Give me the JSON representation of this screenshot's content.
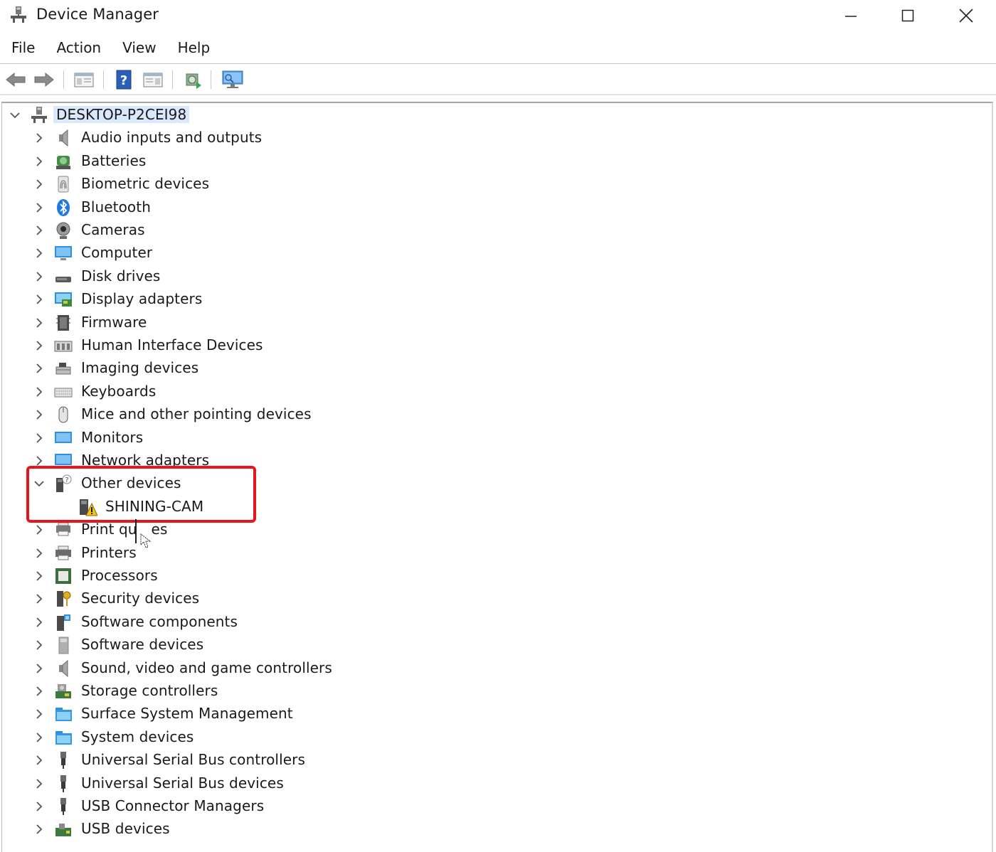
{
  "window": {
    "title": "Device Manager",
    "buttons": [
      "minimize",
      "maximize",
      "close"
    ]
  },
  "menu": [
    "File",
    "Action",
    "View",
    "Help"
  ],
  "toolbar": {
    "icons": [
      "back-arrow-icon",
      "forward-arrow-icon",
      "properties-icon",
      "help-icon",
      "update-driver-icon",
      "scan-hardware-icon",
      "monitor-icon"
    ]
  },
  "tree": {
    "root": {
      "label": "DESKTOP-P2CEI98",
      "expanded": true,
      "selected": true
    },
    "categories": [
      {
        "label": "Audio inputs and outputs",
        "icon": "speaker-icon"
      },
      {
        "label": "Batteries",
        "icon": "battery-icon"
      },
      {
        "label": "Biometric devices",
        "icon": "fingerprint-icon"
      },
      {
        "label": "Bluetooth",
        "icon": "bluetooth-icon"
      },
      {
        "label": "Cameras",
        "icon": "camera-icon"
      },
      {
        "label": "Computer",
        "icon": "computer-icon"
      },
      {
        "label": "Disk drives",
        "icon": "disk-drive-icon"
      },
      {
        "label": "Display adapters",
        "icon": "display-adapter-icon"
      },
      {
        "label": "Firmware",
        "icon": "firmware-icon"
      },
      {
        "label": "Human Interface Devices",
        "icon": "hid-icon"
      },
      {
        "label": "Imaging devices",
        "icon": "imaging-icon"
      },
      {
        "label": "Keyboards",
        "icon": "keyboard-icon"
      },
      {
        "label": "Mice and other pointing devices",
        "icon": "mouse-icon"
      },
      {
        "label": "Monitors",
        "icon": "monitor-icon"
      },
      {
        "label": "Network adapters",
        "icon": "network-adapter-icon"
      },
      {
        "label": "Other devices",
        "icon": "unknown-device-icon",
        "expanded": true,
        "children": [
          {
            "label": "SHINING-CAM",
            "icon": "warning-device-icon"
          }
        ]
      },
      {
        "label": "Print qu",
        "icon": "print-queue-icon",
        "occluded_suffix": "es"
      },
      {
        "label": "Printers",
        "icon": "printer-icon"
      },
      {
        "label": "Processors",
        "icon": "processor-icon"
      },
      {
        "label": "Security devices",
        "icon": "security-key-icon"
      },
      {
        "label": "Software components",
        "icon": "software-component-icon"
      },
      {
        "label": "Software devices",
        "icon": "software-device-icon"
      },
      {
        "label": "Sound, video and game controllers",
        "icon": "speaker-icon"
      },
      {
        "label": "Storage controllers",
        "icon": "storage-controller-icon"
      },
      {
        "label": "Surface System Management",
        "icon": "folder-icon"
      },
      {
        "label": "System devices",
        "icon": "folder-icon"
      },
      {
        "label": "Universal Serial Bus controllers",
        "icon": "usb-icon"
      },
      {
        "label": "Universal Serial Bus devices",
        "icon": "usb-icon"
      },
      {
        "label": "USB Connector Managers",
        "icon": "usb-icon"
      },
      {
        "label": "USB devices",
        "icon": "usb-card-icon"
      }
    ]
  },
  "colors": {
    "selection": "#d9e8fb",
    "highlight_box": "#e8141c",
    "warning": "#f2c21b"
  }
}
